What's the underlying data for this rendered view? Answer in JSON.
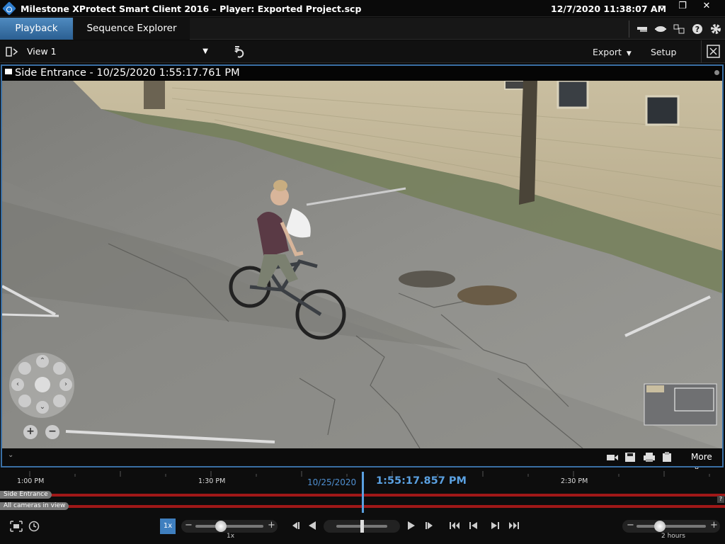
{
  "window": {
    "title": "Milestone XProtect Smart Client 2016 – Player: Exported Project.scp",
    "datetime": "12/7/2020 11:38:07 AM",
    "buttons": {
      "minimize": "–",
      "restore": "❐",
      "close": "✕"
    }
  },
  "tabs": [
    {
      "label": "Playback",
      "active": true
    },
    {
      "label": "Sequence Explorer",
      "active": false
    }
  ],
  "toolbar": {
    "view": "View 1",
    "export_label": "Export",
    "setup_label": "Setup"
  },
  "camera": {
    "title": "Side Entrance - 10/25/2020 1:55:17.761 PM"
  },
  "video_footer": {
    "more_label": "More"
  },
  "timeline": {
    "ticks": [
      "1:00 PM",
      "1:30 PM",
      "2:30 PM"
    ],
    "date": "10/25/2020",
    "current_time": "1:55:17.857 PM",
    "tracks": [
      "Side Entrance",
      "All cameras in view"
    ],
    "help": "?"
  },
  "controls": {
    "speed_button": "1x",
    "speed_label": "1x",
    "range_label": "2 hours"
  },
  "colors": {
    "accent": "#3a6fa4",
    "playhead": "#5aa0e0",
    "track_bar": "#a01818"
  }
}
